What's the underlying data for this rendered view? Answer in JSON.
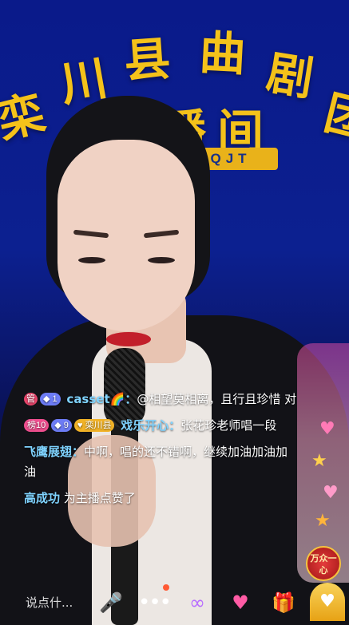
{
  "banner": {
    "characters": [
      "栾",
      "川",
      "县",
      "曲",
      "剧",
      "团",
      "直",
      "播",
      "间"
    ],
    "subtitle": "QJT"
  },
  "chat": {
    "messages": [
      {
        "badges": [
          "管",
          "1"
        ],
        "username": "casset🌈",
        "separator": "：",
        "text": "@相望莫相离，且行且珍惜 对"
      },
      {
        "badges": [
          "榜10",
          "9",
          "栾川县"
        ],
        "username": "戏乐开心",
        "separator": "：",
        "text": "张花珍老师唱一段"
      },
      {
        "badges": [],
        "username": "飞鹰展翅",
        "separator": "：",
        "text": "中啊，唱的还不错啊，继续加油加油加油"
      },
      {
        "badges": [],
        "username": "高成功",
        "separator": "",
        "text": "为主播点赞了"
      }
    ]
  },
  "widgets": {
    "bottom_badge": "万众一心"
  },
  "bottom_bar": {
    "input_placeholder": "说点什...",
    "icons": [
      "mic-icon",
      "more-icon",
      "link-icon",
      "heart-icon",
      "gift-icon",
      "fan-icon"
    ]
  },
  "colors": {
    "banner_gold": "#f4c21a",
    "username_blue": "#7fd3ff",
    "accent_pink": "#ef4f8f"
  }
}
